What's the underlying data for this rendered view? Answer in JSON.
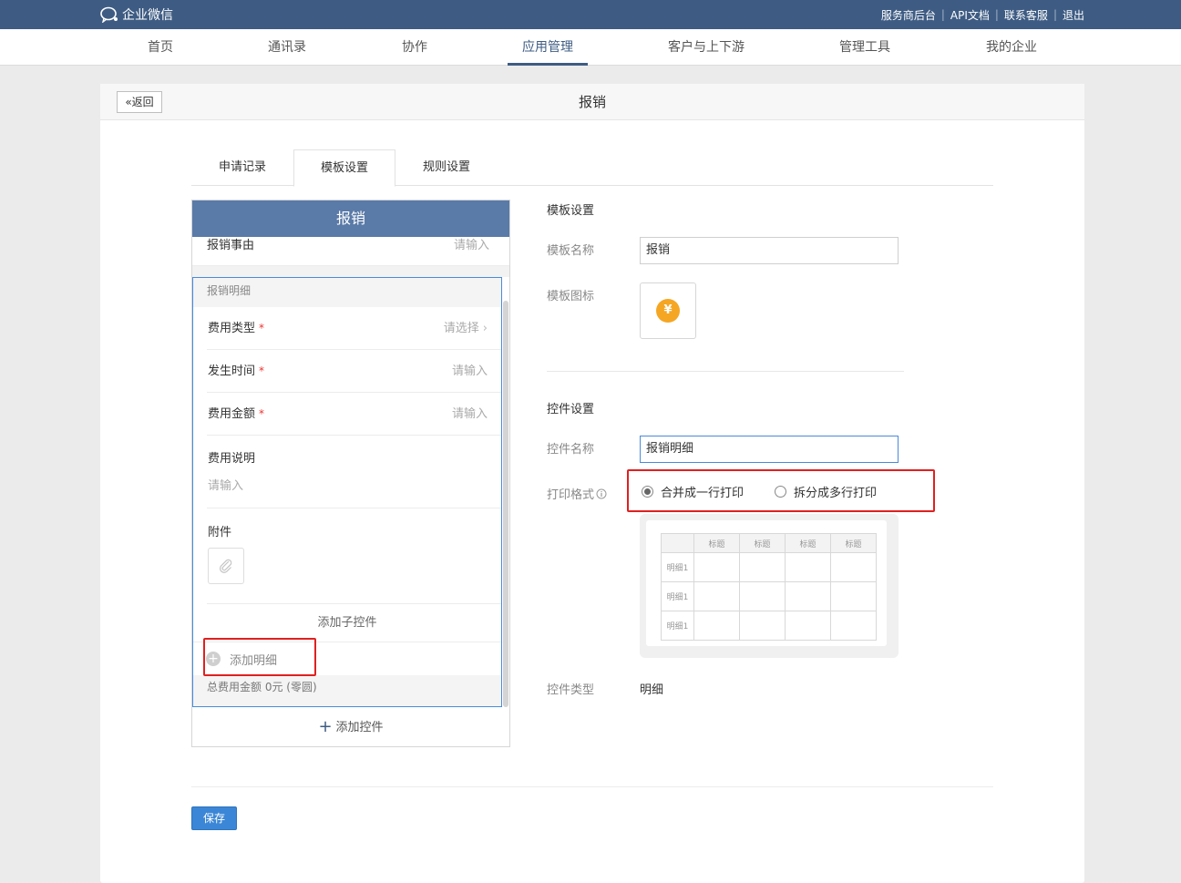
{
  "header": {
    "logo_text": "企业微信",
    "links": [
      "服务商后台",
      "API文档",
      "联系客服",
      "退出"
    ]
  },
  "nav": {
    "items": [
      "首页",
      "通讯录",
      "协作",
      "应用管理",
      "客户与上下游",
      "管理工具",
      "我的企业"
    ],
    "active": "应用管理"
  },
  "page": {
    "back_label": "返回",
    "title": "报销"
  },
  "tabs": [
    "申请记录",
    "模板设置",
    "规则设置"
  ],
  "active_tab": "模板设置",
  "preview": {
    "header": "报销",
    "reason_label": "报销事由",
    "reason_placeholder": "请输入",
    "detail_header": "报销明细",
    "fields": [
      {
        "label": "费用类型",
        "required": "*",
        "placeholder": "请选择"
      },
      {
        "label": "发生时间",
        "required": "*",
        "placeholder": "请输入"
      },
      {
        "label": "费用金额",
        "required": "*",
        "placeholder": "请输入"
      }
    ],
    "desc_label": "费用说明",
    "desc_placeholder": "请输入",
    "attach_label": "附件",
    "add_sub_control": "添加子控件",
    "add_detail": "添加明细",
    "total_text": "总费用金额   0元 (零圆)",
    "add_control": "添加控件"
  },
  "template_settings": {
    "section_title": "模板设置",
    "name_label": "模板名称",
    "name_value": "报销",
    "icon_label": "模板图标",
    "icon_glyph": "¥"
  },
  "control_settings": {
    "section_title": "控件设置",
    "name_label": "控件名称",
    "name_value": "报销明细",
    "print_label": "打印格式",
    "print_options": [
      "合并成一行打印",
      "拆分成多行打印"
    ],
    "print_selected": "合并成一行打印",
    "table_headers": [
      "标题",
      "标题",
      "标题",
      "标题"
    ],
    "table_row_labels": [
      "明细1",
      "明细1",
      "明细1"
    ],
    "type_label": "控件类型",
    "type_value": "明细"
  },
  "save_label": "保存",
  "colors": {
    "topbar": "#3e5c83",
    "phone_header": "#5a7aa8",
    "highlight": "#e02020",
    "primary_button": "#3b86d6",
    "icon_orange": "#f5a623"
  }
}
